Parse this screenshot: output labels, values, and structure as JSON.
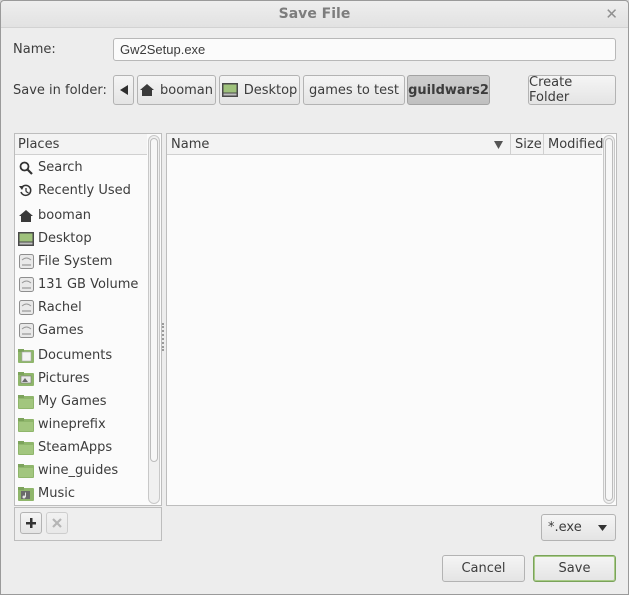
{
  "window": {
    "title": "Save File"
  },
  "name_field": {
    "label": "Name:",
    "value": "Gw2Setup.exe"
  },
  "folder": {
    "label": "Save in folder:",
    "path": [
      {
        "label": "booman",
        "icon": "home-icon"
      },
      {
        "label": "Desktop",
        "icon": "desktop-icon"
      },
      {
        "label": "games to test",
        "icon": ""
      },
      {
        "label": "guildwars2",
        "icon": "",
        "active": true
      }
    ],
    "create_folder_label": "Create Folder"
  },
  "places": {
    "header": "Places",
    "items": [
      {
        "label": "Search",
        "icon": "search-icon"
      },
      {
        "label": "Recently Used",
        "icon": "recent-icon"
      },
      {
        "label": "booman",
        "icon": "home-icon"
      },
      {
        "label": "Desktop",
        "icon": "desktop-icon"
      },
      {
        "label": "File System",
        "icon": "drive-icon"
      },
      {
        "label": "131 GB Volume",
        "icon": "drive-icon"
      },
      {
        "label": "Rachel",
        "icon": "drive-icon"
      },
      {
        "label": "Games",
        "icon": "drive-icon"
      },
      {
        "label": "Documents",
        "icon": "documents-folder-icon"
      },
      {
        "label": "Pictures",
        "icon": "pictures-folder-icon"
      },
      {
        "label": "My Games",
        "icon": "folder-icon"
      },
      {
        "label": "wineprefix",
        "icon": "folder-icon"
      },
      {
        "label": "SteamApps",
        "icon": "folder-icon"
      },
      {
        "label": "wine_guides",
        "icon": "folder-icon"
      },
      {
        "label": "Music",
        "icon": "music-folder-icon"
      }
    ]
  },
  "files": {
    "columns": {
      "name": "Name",
      "size": "Size",
      "modified": "Modified"
    }
  },
  "filter": {
    "selected": "*.exe"
  },
  "actions": {
    "cancel": "Cancel",
    "save": "Save"
  },
  "colors": {
    "folder_green": "#8fb66b",
    "save_border": "#7aa35a"
  }
}
